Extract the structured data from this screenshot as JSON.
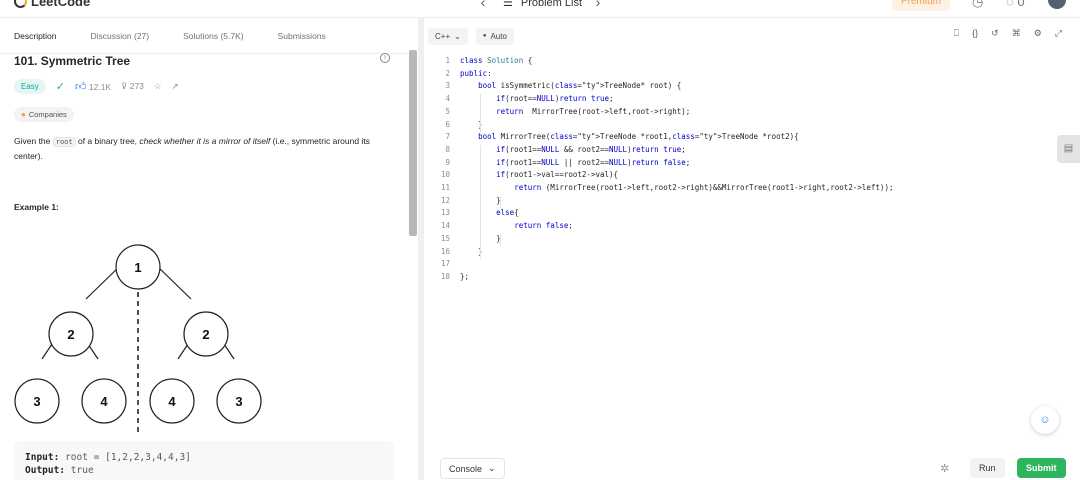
{
  "app": {
    "logo_text": "LeetCode"
  },
  "nav": {
    "prev_icon": "chevron-left-icon",
    "problem_list_label": "Problem List",
    "next_icon": "chevron-right-icon",
    "premium_label": "Premium",
    "streak_count": "0"
  },
  "left_tabs": [
    "Description",
    "Discussion (27)",
    "Solutions (5.7K)",
    "Submissions"
  ],
  "problem": {
    "title": "101. Symmetric Tree",
    "difficulty": "Easy",
    "likes": "12.1K",
    "dislikes": "273",
    "companies_label": "Companies",
    "desc_pre": "Given the ",
    "desc_code": "root",
    "desc_mid": " of a binary tree, ",
    "desc_em": "check whether it is a mirror of itself",
    "desc_post": " (i.e., symmetric around its center).",
    "example_title": "Example 1:",
    "tree_nodes": [
      "1",
      "2",
      "2",
      "3",
      "4",
      "4",
      "3"
    ],
    "input_label": "Input:",
    "input_value": "root = [1,2,2,3,4,4,3]",
    "output_label": "Output:",
    "output_value": "true"
  },
  "editor": {
    "language": "C++",
    "mode": "Auto",
    "lines": [
      "class Solution {",
      "public:",
      "    bool isSymmetric(TreeNode* root) {",
      "        if(root==NULL)return true;",
      "        return  MirrorTree(root->left,root->right);",
      "    }",
      "    bool MirrorTree(TreeNode *root1,TreeNode *root2){",
      "        if(root1==NULL && root2==NULL)return true;",
      "        if(root1==NULL || root2==NULL)return false;",
      "        if(root1->val==root2->val){",
      "            return (MirrorTree(root1->left,root2->right)&&MirrorTree(root1->right,root2->left));",
      "        }",
      "        else{",
      "            return false;",
      "        }",
      "    }",
      "",
      "};"
    ]
  },
  "bottom": {
    "console_label": "Console",
    "run_label": "Run",
    "submit_label": "Submit"
  }
}
